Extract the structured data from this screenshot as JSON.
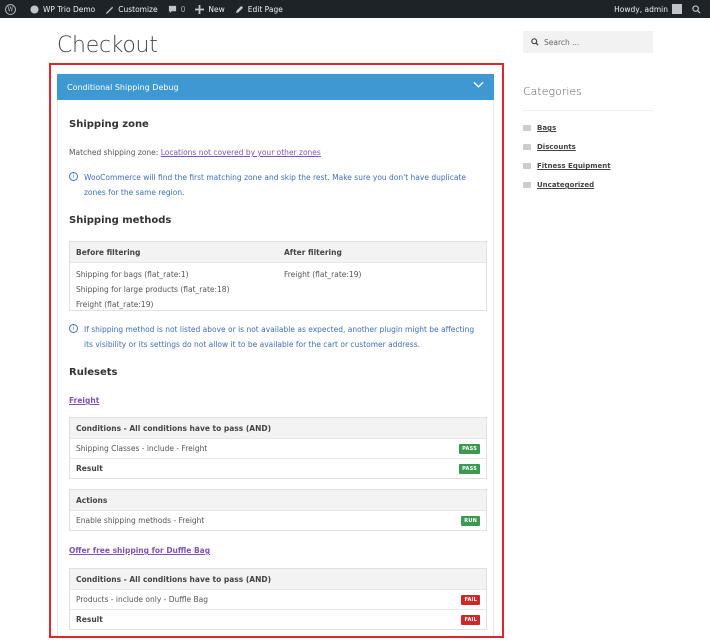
{
  "admin_bar": {
    "site_name": "WP Trio Demo",
    "customize": "Customize",
    "comments_count": "0",
    "new": "New",
    "edit_page": "Edit Page",
    "howdy": "Howdy, admin"
  },
  "page": {
    "title": "Checkout"
  },
  "debug": {
    "header": "Conditional Shipping Debug",
    "zone_heading": "Shipping zone",
    "matched_label": "Matched shipping zone: ",
    "matched_link": "Locations not covered by your other zones",
    "zone_info": "WooCommerce will find the first matching zone and skip the rest. Make sure you don't have duplicate zones for the same region.",
    "methods_heading": "Shipping methods",
    "methods_table": {
      "before_header": "Before filtering",
      "after_header": "After filtering",
      "before": [
        "Shipping for bags (flat_rate:1)",
        "Shipping for large products (flat_rate:18)",
        "Freight (flat_rate:19)"
      ],
      "after": [
        "Freight (flat_rate:19)"
      ]
    },
    "methods_info": "If shipping method is not listed above or is not available as expected, another plugin might be affecting its visibility or its settings do not allow it to be available for the cart or customer address.",
    "rulesets_heading": "Rulesets",
    "rulesets": [
      {
        "name": "Freight",
        "conditions_header": "Conditions - All conditions have to pass (AND)",
        "conditions": [
          {
            "label": "Shipping Classes - include - Freight",
            "status": "PASS"
          }
        ],
        "result_label": "Result",
        "result_status": "PASS",
        "actions_header": "Actions",
        "actions": [
          {
            "label": "Enable shipping methods - Freight",
            "status": "RUN"
          }
        ]
      },
      {
        "name": "Offer free shipping for Duffle Bag",
        "conditions_header": "Conditions - All conditions have to pass (AND)",
        "conditions": [
          {
            "label": "Products - include only - Duffle Bag",
            "status": "FAIL"
          }
        ],
        "result_label": "Result",
        "result_status": "FAIL"
      }
    ]
  },
  "sidebar": {
    "search_placeholder": "Search ...",
    "categories_title": "Categories",
    "categories": [
      "Bags",
      "Discounts",
      "Fitness Equipment",
      "Uncategorized"
    ]
  },
  "colors": {
    "header_blue": "#3e98d1",
    "pass_green": "#3d9951",
    "fail_red": "#cc2a2a",
    "highlight_red": "#e0262b",
    "link_purple": "#7f54b3"
  }
}
